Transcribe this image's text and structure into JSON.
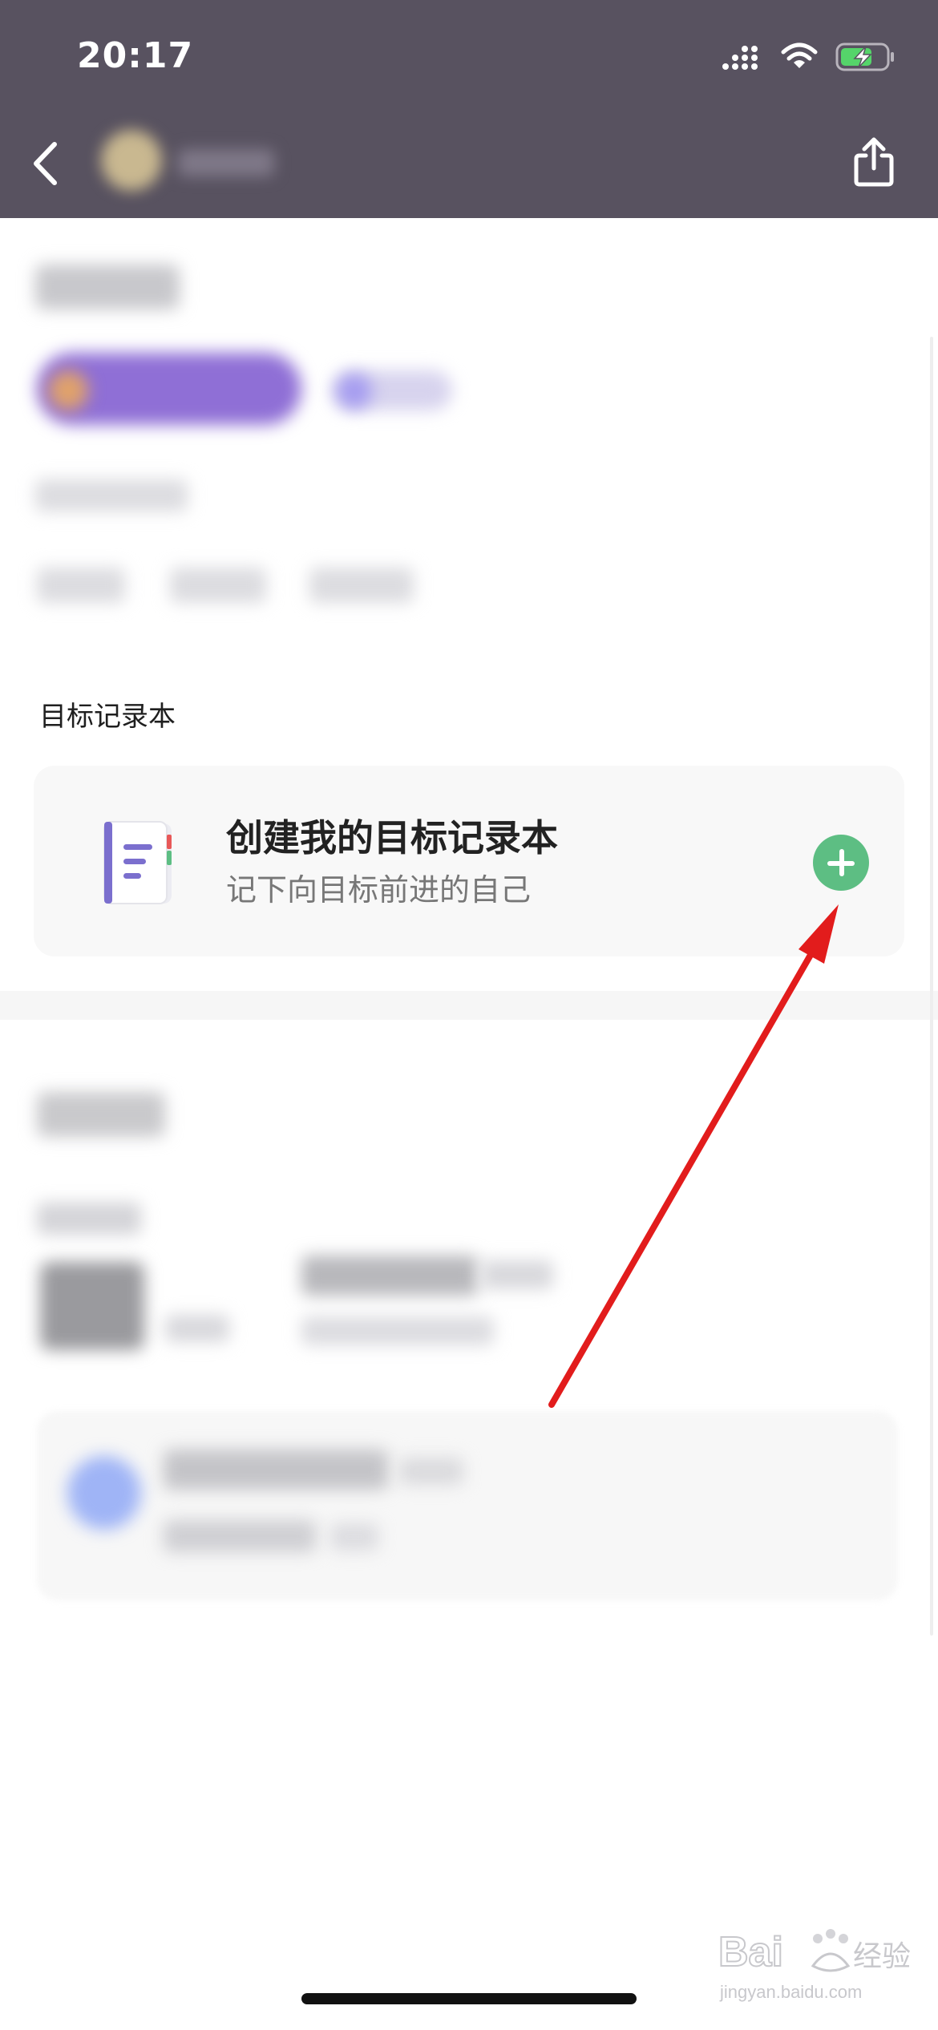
{
  "status_bar": {
    "time": "20:17"
  },
  "header": {
    "back_label": "",
    "share_label": ""
  },
  "goal_section": {
    "title": "目标记录本",
    "card": {
      "title": "创建我的目标记录本",
      "subtitle": "记下向目标前进的自己"
    }
  },
  "colors": {
    "header_bg": "#585260",
    "add_button": "#5dbe83",
    "notebook_accent": "#7b6fce",
    "annotation_arrow": "#e21c1c"
  },
  "watermark": {
    "brand": "Bai",
    "brand_tail": "经验",
    "url": "jingyan.baidu.com"
  }
}
